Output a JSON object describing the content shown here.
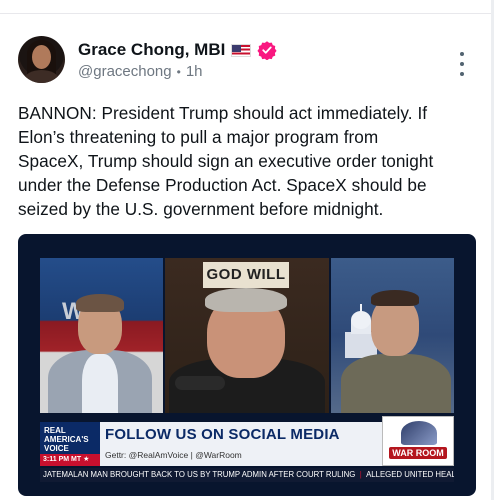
{
  "post": {
    "author_name": "Grace Chong, MBI",
    "handle": "@gracechong",
    "separator": "•",
    "time_ago": "1h",
    "text": "BANNON: President Trump should act immediately. If\nElon’s threatening to pull a major program from\nSpaceX, Trump should sign an executive order tonight\nunder the Defense Production Act. SpaceX should be\nseized by the U.S. government before midnight."
  },
  "media": {
    "sign_text": "GOD WILL",
    "background_logo": "WAR",
    "brand": {
      "line1": "REAL",
      "line2": "AMERICA'S",
      "line3": "VOICE",
      "time": "3:11 PM MT ★"
    },
    "headline": "FOLLOW US ON SOCIAL MEDIA",
    "subline": "Gettr: @RealAmVoice | @WarRoom",
    "warroom_label": "WAR ROOM",
    "ticker_left": "JATEMALAN MAN BROUGHT BACK TO US BY TRUMP ADMIN AFTER COURT RULING",
    "ticker_right": "ALLEGED UNITED HEALT"
  },
  "colors": {
    "verified": "#f91880",
    "brand_blue": "#0b2a66",
    "brand_red": "#c8102e"
  },
  "icons": [
    "us-flag-icon",
    "verified-badge-icon",
    "more-options-icon"
  ]
}
